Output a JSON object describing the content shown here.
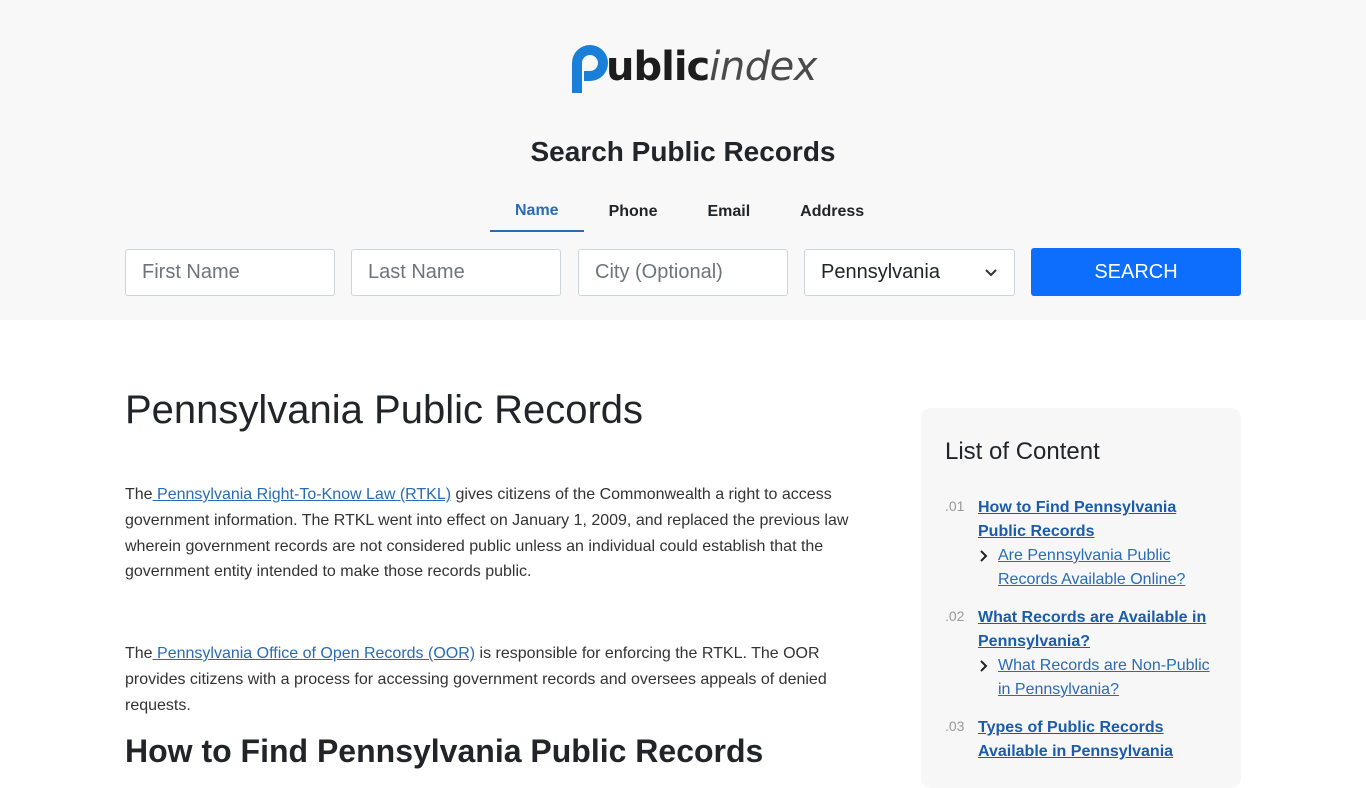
{
  "logo": {
    "text_bold": "ublic",
    "text_light": "index"
  },
  "search": {
    "title": "Search Public Records",
    "tabs": [
      "Name",
      "Phone",
      "Email",
      "Address"
    ],
    "first_name_placeholder": "First Name",
    "last_name_placeholder": "Last Name",
    "city_placeholder": "City (Optional)",
    "state_selected": "Pennsylvania",
    "button_label": "SEARCH"
  },
  "main": {
    "title": "Pennsylvania Public Records",
    "p1_prefix": "The",
    "p1_link": " Pennsylvania Right-To-Know Law (RTKL)",
    "p1_rest": " gives citizens of the Commonwealth a right to access government information. The RTKL went into effect on January 1, 2009, and replaced the previous law wherein government records are not considered public unless an individual could establish that the government entity intended to make those records public.",
    "p2_prefix": "The",
    "p2_link": " Pennsylvania Office of Open Records (OOR)",
    "p2_rest": " is responsible for enforcing the RTKL. The OOR provides citizens with a process for accessing government records and oversees appeals of denied requests.",
    "h2": "How to Find Pennsylvania Public Records"
  },
  "toc": {
    "title": "List of Content",
    "items": [
      {
        "num": ".01",
        "label": "How to Find Pennsylvania Public Records",
        "sub": "Are Pennsylvania Public Records Available Online?"
      },
      {
        "num": ".02",
        "label": "What Records are Available in Pennsylvania?",
        "sub": "What Records are Non-Public in Pennsylvania?"
      },
      {
        "num": ".03",
        "label": "Types of Public Records Available in Pennsylvania",
        "sub": ""
      }
    ]
  },
  "colors": {
    "accent": "#2a6bb5",
    "button": "#0d6efd",
    "header_bg": "#f8f8f9"
  }
}
